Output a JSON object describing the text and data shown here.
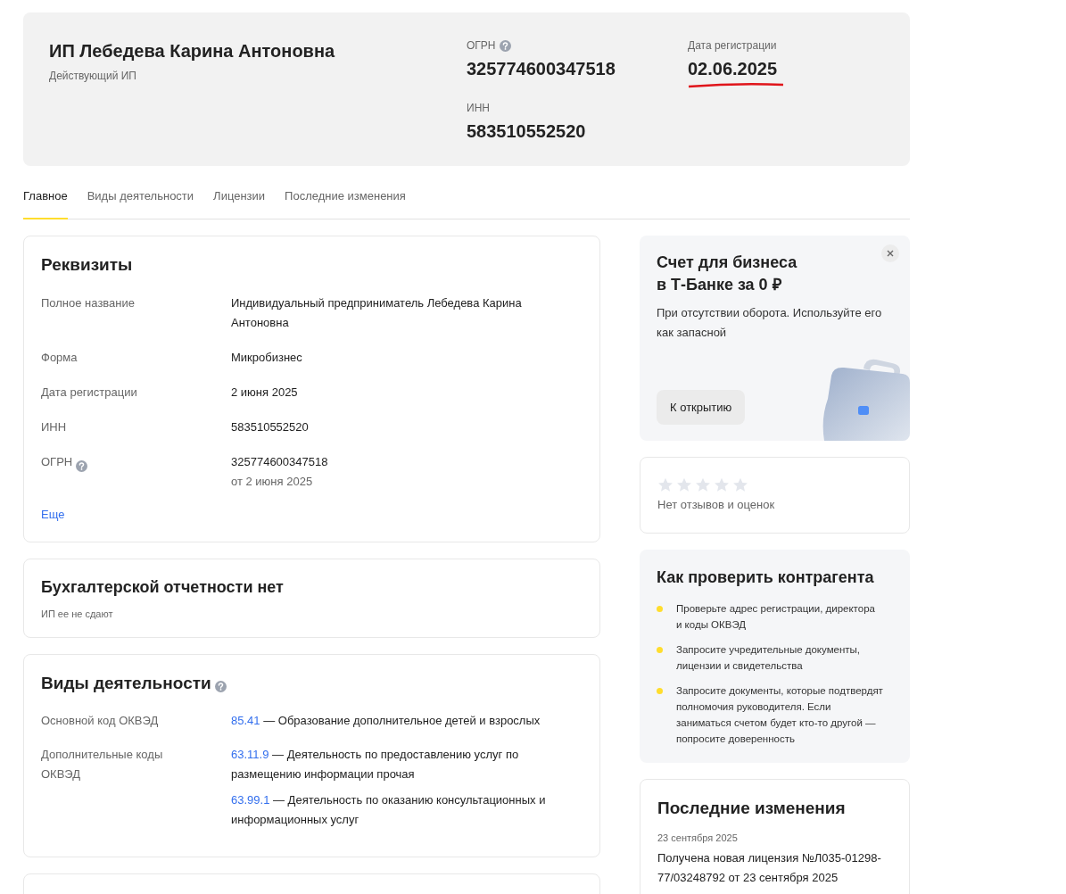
{
  "header": {
    "name": "ИП Лебедева Карина Антоновна",
    "status": "Действующий ИП",
    "ogrn_label": "ОГРН",
    "ogrn": "325774600347518",
    "inn_label": "ИНН",
    "inn": "583510552520",
    "reg_label": "Дата регистрации",
    "reg_date": "02.06.2025"
  },
  "tabs": [
    {
      "label": "Главное",
      "selected": true
    },
    {
      "label": "Виды деятельности",
      "selected": false
    },
    {
      "label": "Лицензии",
      "selected": false
    },
    {
      "label": "Последние изменения",
      "selected": false
    }
  ],
  "requisites": {
    "title": "Реквизиты",
    "rows": [
      {
        "label": "Полное название",
        "value": "Индивидуальный предприниматель Лебедева Карина Антоновна"
      },
      {
        "label": "Форма",
        "value": "Микробизнес"
      },
      {
        "label": "Дата регистрации",
        "value": "2 июня 2025"
      },
      {
        "label": "ИНН",
        "value": "583510552520"
      },
      {
        "label": "ОГРН",
        "value": "325774600347518",
        "note": "от 2 июня 2025",
        "help": true
      }
    ],
    "more": "Еще"
  },
  "accounting": {
    "title": "Бухгалтерской отчетности нет",
    "subtitle": "ИП ее не сдают"
  },
  "activities": {
    "title": "Виды деятельности",
    "groups": [
      {
        "label": "Основной код ОКВЭД",
        "items": [
          {
            "code": "85.41",
            "text": "— Образование дополнительное детей и взрослых"
          }
        ]
      },
      {
        "label": "Дополнительные коды ОКВЭД",
        "items": [
          {
            "code": "63.11.9",
            "text": "— Деятельность по предоставлению услуг по размещению информации прочая"
          },
          {
            "code": "63.99.1",
            "text": "— Деятельность по оказанию консультационных и информационных услуг"
          }
        ]
      }
    ]
  },
  "promo": {
    "title": "Счет для бизнеса в Т-Банке за 0 ₽",
    "text": "При отсутствии оборота. Используйте его как запасной",
    "button": "К открытию"
  },
  "reviews": {
    "stars": 0,
    "text": "Нет отзывов и оценок"
  },
  "checklist": {
    "title": "Как проверить контрагента",
    "items": [
      "Проверьте адрес регистрации, директора и коды ОКВЭД",
      "Запросите учредительные документы, лицензии и свидетельства",
      "Запросите документы, которые подтвердят полномочия руководителя. Если заниматься счетом будет кто-то другой — попросите доверенность"
    ]
  },
  "changes": {
    "title": "Последние изменения",
    "items": [
      {
        "date": "23 сентября 2025",
        "text": "Получена новая лицензия №Л035-01298-77/03248792 от 23 сентября 2025"
      }
    ]
  }
}
